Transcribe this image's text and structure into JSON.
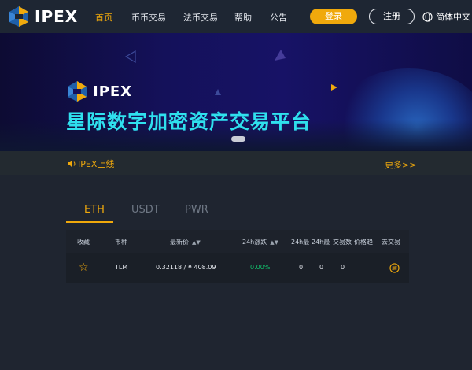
{
  "brand": {
    "name": "IPEX"
  },
  "nav": {
    "items": [
      {
        "label": "首页",
        "active": true
      },
      {
        "label": "币币交易",
        "active": false
      },
      {
        "label": "法币交易",
        "active": false
      },
      {
        "label": "帮助",
        "active": false
      },
      {
        "label": "公告",
        "active": false
      }
    ],
    "login_label": "登录",
    "register_label": "注册",
    "language_label": "简体中文"
  },
  "banner": {
    "logo_text": "IPEX",
    "slogan": "星际数字加密资产交易平台"
  },
  "notice": {
    "text": "IPEX上线",
    "more_label": "更多>>"
  },
  "market": {
    "tabs": [
      {
        "label": "ETH",
        "active": true
      },
      {
        "label": "USDT",
        "active": false
      },
      {
        "label": "PWR",
        "active": false
      }
    ],
    "columns": {
      "favorite": "收藏",
      "coin": "币种",
      "price": "最新价",
      "change": "24h涨跌",
      "high": "24h最",
      "low": "24h最",
      "volume": "交易数",
      "trend": "价格趋",
      "trade": "去交易"
    },
    "rows": [
      {
        "favorite_icon": "star-outline-icon",
        "coin": "TLM",
        "price": "0.32118 / ¥ 408.09",
        "change": "0.00%",
        "high": "0",
        "low": "0",
        "volume": "0",
        "trade_icon": "exchange-icon"
      }
    ]
  },
  "colors": {
    "accent": "#f0a90c",
    "background": "#1f2530",
    "header": "#1e2633",
    "slogan": "#2fe0ee",
    "positive": "#11c26d"
  }
}
